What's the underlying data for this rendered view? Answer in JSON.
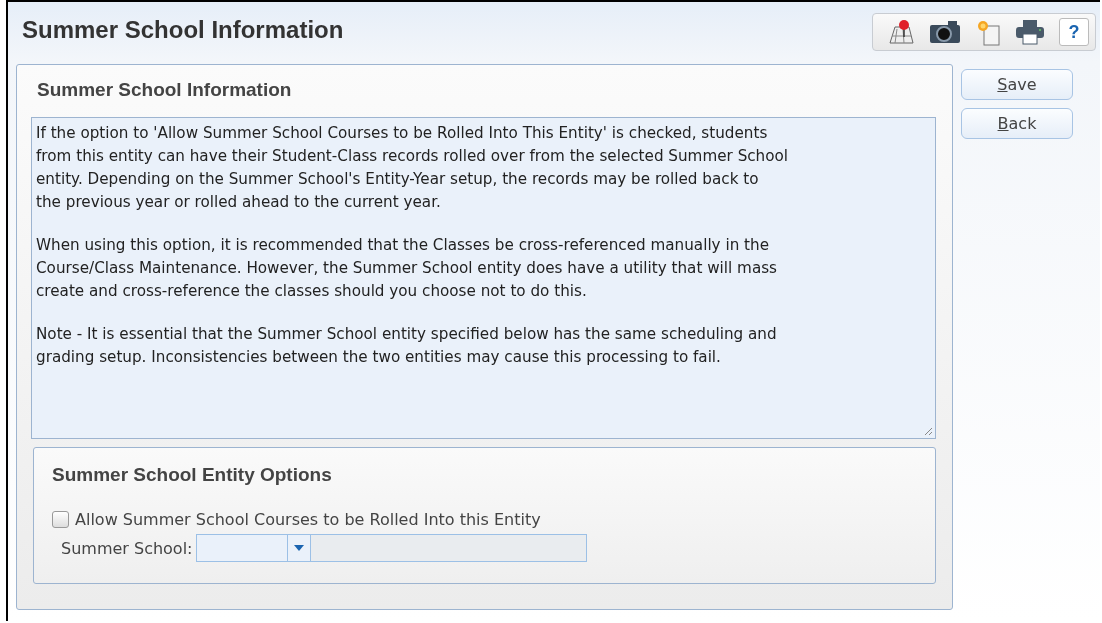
{
  "window": {
    "title": "Summer School Information"
  },
  "toolbar": {
    "help_label": "?"
  },
  "actions": [
    {
      "label": "Save"
    },
    {
      "label": "Back"
    }
  ],
  "info_panel": {
    "title": "Summer School Information",
    "paragraphs": [
      "If the option to 'Allow Summer School Courses to be Rolled Into This Entity' is checked, students\nfrom this entity can have their Student-Class records rolled over from the selected Summer School\nentity. Depending on the Summer School's Entity-Year setup, the records may be rolled back to\nthe previous year or rolled ahead to the current year.",
      "When using this option, it is recommended that the Classes be cross-referenced manually in the\nCourse/Class Maintenance. However, the Summer School entity does have a utility that will mass\ncreate and cross-reference the classes should you choose not to do this.",
      "Note - It is essential that the Summer School entity specified below has the same scheduling and\ngrading setup. Inconsistencies between the two entities may cause this processing to fail."
    ]
  },
  "options": {
    "title": "Summer School Entity Options",
    "allow_rollover": {
      "label": "Allow Summer School Courses to be Rolled Into this Entity",
      "checked": false
    },
    "summer_school": {
      "label": "Summer School:"
    }
  }
}
